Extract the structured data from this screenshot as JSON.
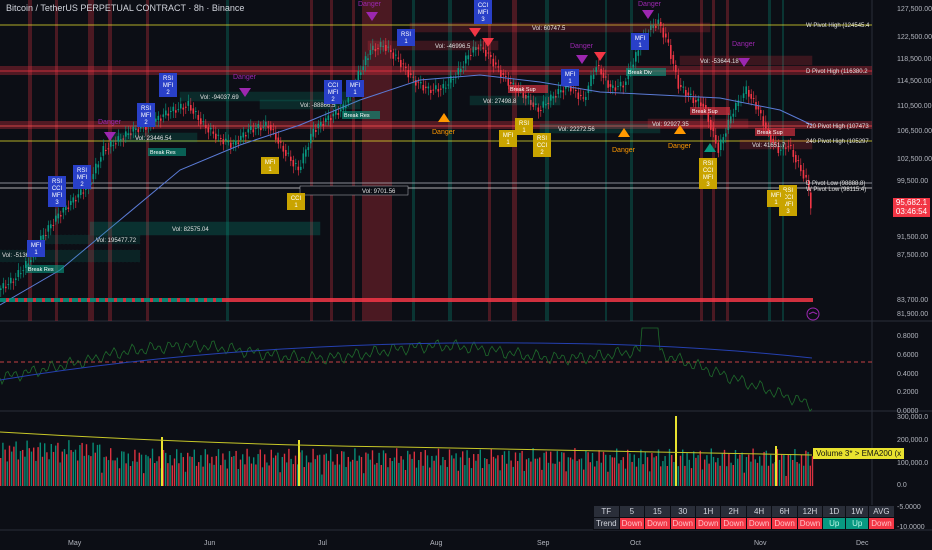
{
  "header": {
    "title": "Bitcoin / TetherUS PERPETUAL CONTRACT · 8h · Binance"
  },
  "price_axis": {
    "ticks": [
      "127,500.00",
      "122,500.00",
      "118,500.00",
      "114,500.00",
      "110,500.00",
      "106,500.00",
      "102,500.00",
      "99,500.00",
      "95,500.00",
      "91,500.00",
      "87,500.00",
      "83,700.00",
      "81,900.00"
    ],
    "current_price": "95,682.1",
    "countdown": "03:46:54"
  },
  "oscillator_axis": {
    "ticks": [
      "0.8000",
      "0.6000",
      "0.4000",
      "0.2000",
      "0.0000"
    ]
  },
  "volume_axis": {
    "ticks": [
      "300,000.0",
      "200,000.0",
      "100,000.0",
      "0.0",
      "-5.0000",
      "-10.0000"
    ]
  },
  "time_axis": {
    "labels": [
      "May",
      "Jun",
      "Jul",
      "Aug",
      "Sep",
      "Oct",
      "Nov",
      "Dec"
    ]
  },
  "pivots": [
    "W Pivot High (124545.4",
    "D Pivot High (116380.2",
    "720 Pivot High (107473",
    "240 Pivot High (105297",
    "D Pivot Low (98888.8)",
    "W Pivot Low (98115.4)"
  ],
  "signals": {
    "danger": "Danger",
    "break_res": "Break Res",
    "break_sup": "Break Sup",
    "break_div": "Break Div",
    "rsi": "RSI",
    "cci": "CCI",
    "mfi": "MFI"
  },
  "vol_boxes": [
    "Vol: 60747.5",
    "Vol: -46996.5",
    "Vol: -53644.18",
    "Vol: -94037.69",
    "Vol: -88866.5",
    "Vol: 23446.54",
    "Vol: 27498.8",
    "Vol: 22272.56",
    "Vol: 92927.35",
    "Vol: 41651.7",
    "Vol: 9701.56",
    "Vol: 82575.04",
    "Vol: 195477.72",
    "Vol: -51363"
  ],
  "volume_legend": "Volume 3* > EMA200 (x",
  "trend_table": {
    "headers": [
      "TF",
      "5",
      "15",
      "30",
      "1H",
      "2H",
      "4H",
      "6H",
      "12H",
      "1D",
      "1W",
      "AVG"
    ],
    "row_label": "Trend",
    "values": [
      "Down",
      "Down",
      "Down",
      "Down",
      "Down",
      "Down",
      "Down",
      "Down",
      "Up",
      "Up",
      "Down"
    ]
  },
  "colors": {
    "up": "#089981",
    "down": "#f23645",
    "danger_purple": "#9c27b0",
    "danger_orange": "#ff9800",
    "rsi_blue": "#2940c8",
    "gold": "#c9a400"
  },
  "icons": {
    "tv_logo": "tradingview-icon"
  }
}
